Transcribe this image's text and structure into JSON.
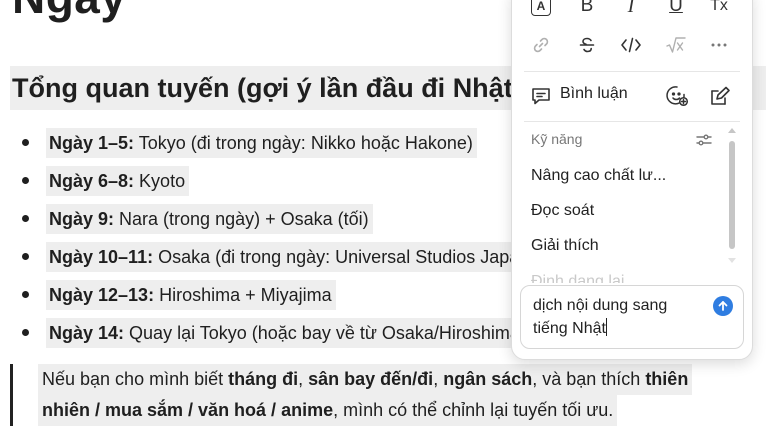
{
  "document": {
    "title": "Ngày",
    "section_heading": "Tổng quan tuyến (gợi ý lần đầu đi Nhật)",
    "itinerary": [
      {
        "label": "Ngày 1–5:",
        "text": " Tokyo (đi trong ngày: Nikko hoặc Hakone)"
      },
      {
        "label": "Ngày 6–8:",
        "text": " Kyoto"
      },
      {
        "label": "Ngày 9:",
        "text": " Nara (trong ngày) + Osaka (tối)"
      },
      {
        "label": "Ngày 10–11:",
        "text": " Osaka (đi trong ngày: Universal Studios Japan)"
      },
      {
        "label": "Ngày 12–13:",
        "text": " Hiroshima + Miyajima"
      },
      {
        "label": "Ngày 14:",
        "text": " Quay lại Tokyo (hoặc bay về từ Osaka/Hiroshima)"
      }
    ],
    "note": {
      "t1": "Nếu bạn cho mình biết ",
      "b1": "tháng đi",
      "t2": ", ",
      "b2": "sân bay đến/đi",
      "t3": ", ",
      "b3": "ngân sách",
      "t4": ", và bạn thích ",
      "b4": "thiên",
      "b5": "nhiên / mua sắm / văn hoá / anime",
      "t5": ", mình có thể chỉnh lại tuyến tối ưu."
    }
  },
  "panel": {
    "toolbar": {
      "row1": [
        "text-color-icon",
        "bold-icon",
        "italic-icon",
        "underline-icon",
        "clear-format-icon"
      ],
      "text_color_glyph": "A",
      "bold_glyph": "B",
      "italic_glyph": "I",
      "underline_glyph": "U",
      "clear_glyph": "Tx"
    },
    "comment_label": "Bình luận",
    "skills_title": "Kỹ năng",
    "skills": [
      {
        "label": "Nâng cao chất lư..."
      },
      {
        "label": "Đọc soát"
      },
      {
        "label": "Giải thích"
      },
      {
        "label": "Định dạng lại"
      }
    ],
    "input_value_line1": "dịch nội dung sang",
    "input_value_line2": "tiếng Nhật"
  }
}
